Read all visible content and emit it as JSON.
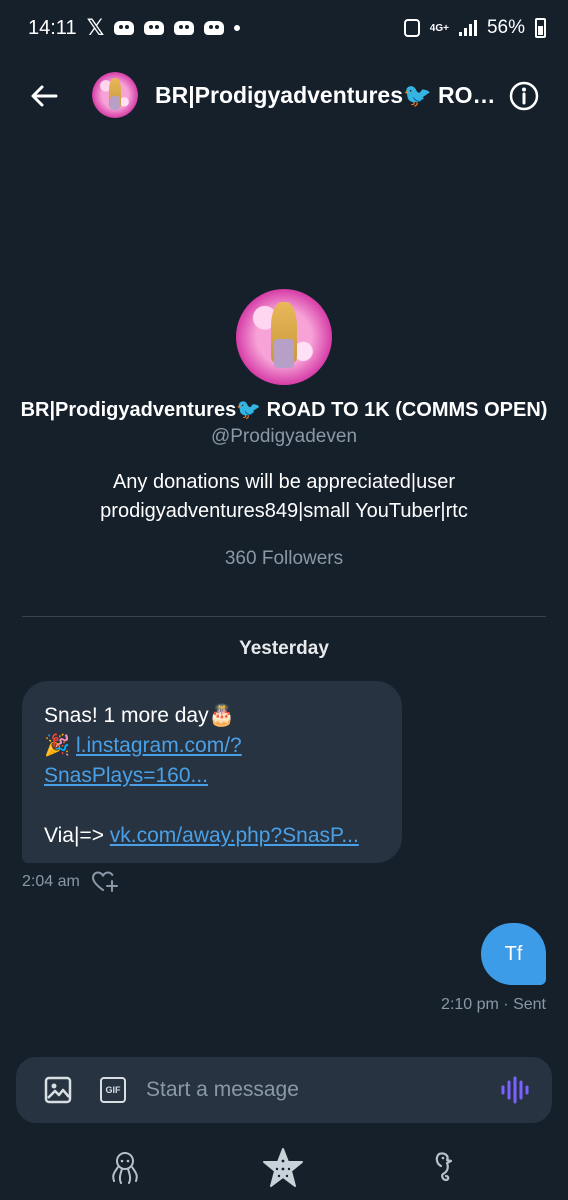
{
  "status_bar": {
    "time": "14:11",
    "x_glyph": "𝕏",
    "network": "4G+",
    "battery": "56%"
  },
  "header": {
    "title": "BR|Prodigyadventures🐦 ROAD TO 1K (COMMS OPEN)",
    "back_icon": "arrow-left-icon",
    "info_icon": "info-icon"
  },
  "profile": {
    "name": "BR|Prodigyadventures🐦 ROAD TO 1K (COMMS OPEN)",
    "handle": "@Prodigyadeven",
    "bio": "Any donations will be appreciated|user prodigyadventures849|small YouTuber|rtc",
    "followers": "360 Followers"
  },
  "conversation": {
    "date_separator": "Yesterday",
    "incoming": {
      "line1": "Snas! 1 more day🎂",
      "line2_emoji": "🎉",
      "link1_part1": "l.instagram.com/?",
      "link1_part2": "SnasPlays=160...",
      "line3_prefix": "Via|=> ",
      "link2": "vk.com/away.php?SnasP...",
      "time": "2:04 am"
    },
    "outgoing": {
      "text": "Tf",
      "meta": "2:10 pm · Sent"
    }
  },
  "composer": {
    "placeholder": "Start a message",
    "gif_label": "GIF"
  },
  "colors": {
    "background": "#15202b",
    "bubble_in": "#273340",
    "bubble_out": "#3c9ce8",
    "link": "#4aa0e6",
    "muted": "#8b98a5",
    "voice_accent": "#7b61ff"
  }
}
